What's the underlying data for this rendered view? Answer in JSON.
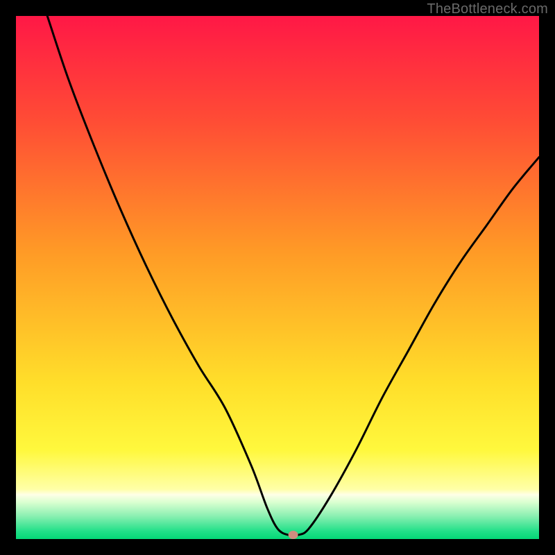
{
  "watermark": "TheBottleneck.com",
  "chart_data": {
    "type": "line",
    "title": "",
    "xlabel": "",
    "ylabel": "",
    "xlim": [
      0,
      100
    ],
    "ylim": [
      0,
      100
    ],
    "series": [
      {
        "name": "bottleneck-curve",
        "x": [
          6,
          10,
          15,
          20,
          25,
          30,
          35,
          40,
          45,
          48,
          50,
          52,
          54,
          56,
          60,
          65,
          70,
          75,
          80,
          85,
          90,
          95,
          100
        ],
        "y": [
          100,
          88,
          75,
          63,
          52,
          42,
          33,
          25,
          14,
          6,
          2,
          0.8,
          0.8,
          2,
          8,
          17,
          27,
          36,
          45,
          53,
          60,
          67,
          73
        ]
      }
    ],
    "marker": {
      "x": 53,
      "y": 0.8,
      "color": "#cf8d7f"
    },
    "gradient_stops": [
      {
        "pos": 0.0,
        "color": "#ff1846"
      },
      {
        "pos": 0.2,
        "color": "#ff4c35"
      },
      {
        "pos": 0.45,
        "color": "#ff9a26"
      },
      {
        "pos": 0.7,
        "color": "#ffde2a"
      },
      {
        "pos": 0.83,
        "color": "#fff83d"
      },
      {
        "pos": 0.905,
        "color": "#ffffa8"
      },
      {
        "pos": 0.915,
        "color": "#ffffe6"
      },
      {
        "pos": 0.93,
        "color": "#d9ffd0"
      },
      {
        "pos": 0.955,
        "color": "#8ef0b3"
      },
      {
        "pos": 0.985,
        "color": "#22e089"
      },
      {
        "pos": 1.0,
        "color": "#04d877"
      }
    ]
  }
}
